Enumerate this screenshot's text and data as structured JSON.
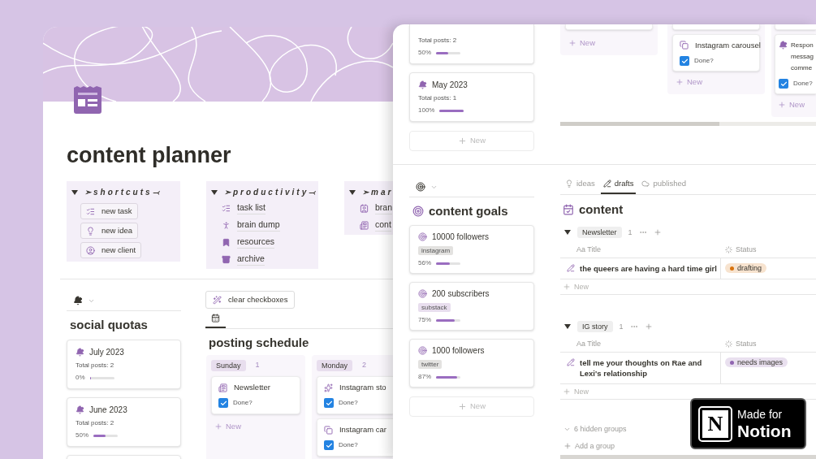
{
  "planner": {
    "title": "content planner",
    "callouts": [
      {
        "title": "➣shortcuts⤙",
        "expanded": true,
        "kind": "buttons",
        "items": [
          "new task",
          "new idea",
          "new client"
        ]
      },
      {
        "title": "➣productivity⤙",
        "expanded": true,
        "kind": "links",
        "items": [
          "task list",
          "brain dump",
          "resources",
          "archive"
        ]
      },
      {
        "title": "➣mar",
        "expanded": true,
        "kind": "links",
        "items": [
          "bran",
          "cont"
        ]
      }
    ],
    "quotas": {
      "title": "social quotas",
      "cards": [
        {
          "title": "July 2023",
          "total": "Total posts: 2",
          "percent": "0%",
          "level": 0
        },
        {
          "title": "June 2023",
          "total": "Total posts: 2",
          "percent": "50%",
          "level": 0.5
        }
      ]
    },
    "schedule": {
      "button": "clear checkboxes",
      "title": "posting schedule",
      "columns": [
        {
          "day": "Sunday",
          "count": "1",
          "new": "New",
          "cards": [
            {
              "title": "Newsletter",
              "check_label": "Done?",
              "checked": true
            }
          ]
        },
        {
          "day": "Monday",
          "count": "2",
          "cards": [
            {
              "title": "Instagram sto",
              "check_label": "Done?",
              "checked": true
            },
            {
              "title": "Instagram car",
              "check_label": "Done?",
              "checked": true
            }
          ]
        }
      ]
    }
  },
  "second_window": {
    "quota_cards": [
      {
        "total": "Total posts: 2",
        "percent": "50%",
        "level": 0.5
      },
      {
        "title": "May 2023",
        "total": "Total posts: 1",
        "percent": "100%",
        "level": 1
      }
    ],
    "quota_new": "New",
    "goals": {
      "title": "content goals",
      "new": "New",
      "cards": [
        {
          "title": "10000 followers",
          "tag": "instagram",
          "color": "#e3e2e0",
          "percent": "56%",
          "level": 0.56
        },
        {
          "title": "200 subscribers",
          "tag": "substack",
          "color": "#e8deee",
          "percent": "75%",
          "level": 0.75
        },
        {
          "title": "1000 followers",
          "tag": "twitter",
          "color": "#e3e2e0",
          "percent": "87%",
          "level": 0.87
        }
      ]
    },
    "board_columns": [
      {
        "new": "New"
      },
      {
        "new": "New",
        "cards": [
          {
            "lines": [
              "Instagram carousel"
            ],
            "check_label": "Done?",
            "checked": true
          }
        ]
      },
      {
        "new": "New",
        "cards": [
          {
            "lines": [
              "Respon",
              "messag",
              "comme"
            ],
            "check_label": "Done?",
            "checked": true
          }
        ]
      }
    ],
    "tabs": [
      {
        "label": "ideas",
        "selected": false
      },
      {
        "label": "drafts",
        "selected": true
      },
      {
        "label": "published",
        "selected": false
      }
    ],
    "content": {
      "title": "content",
      "groups": [
        {
          "name": "Newsletter",
          "count": "1",
          "expanded": true,
          "columns": [
            "Aa Title",
            "Status"
          ],
          "rows": [
            {
              "title": "the queers are having a hard time girl",
              "status": "drafting",
              "color": "#d9730d"
            }
          ],
          "new": "New"
        },
        {
          "name": "IG story",
          "count": "1",
          "expanded": true,
          "columns": [
            "Aa Title",
            "Status"
          ],
          "rows": [
            {
              "title": "tell me your thoughts on Rae and Lexi's relationship",
              "status": "needs images",
              "color": "#9065b0"
            }
          ],
          "new": "New"
        }
      ],
      "hidden_groups": "6 hidden groups",
      "add_group": "Add a group"
    }
  },
  "badge": {
    "logo": "N",
    "line1": "Made for",
    "line2": "Notion"
  }
}
